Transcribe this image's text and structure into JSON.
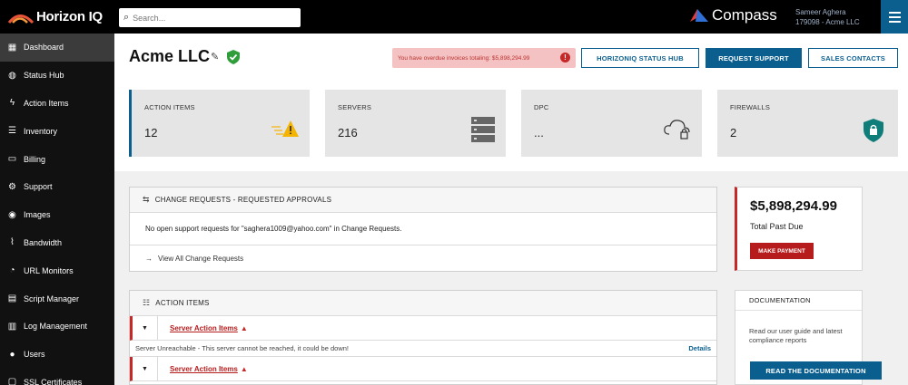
{
  "brand": {
    "name": "Horizon IQ"
  },
  "search": {
    "placeholder": "Search..."
  },
  "compass": {
    "label": "Compass"
  },
  "user": {
    "name": "Sameer Aghera",
    "account": "179098 - Acme LLC"
  },
  "sidebar": {
    "items": [
      {
        "label": "Dashboard",
        "icon": "dashboard-icon",
        "active": true
      },
      {
        "label": "Status Hub",
        "icon": "globe-icon"
      },
      {
        "label": "Action Items",
        "icon": "bolt-icon"
      },
      {
        "label": "Inventory",
        "icon": "server-icon"
      },
      {
        "label": "Billing",
        "icon": "card-icon"
      },
      {
        "label": "Support",
        "icon": "gear-icon"
      },
      {
        "label": "Images",
        "icon": "disc-icon"
      },
      {
        "label": "Bandwidth",
        "icon": "chart-icon"
      },
      {
        "label": "URL Monitors",
        "icon": "monitor-icon"
      },
      {
        "label": "Script Manager",
        "icon": "script-icon"
      },
      {
        "label": "Log Management",
        "icon": "log-icon"
      },
      {
        "label": "Users",
        "icon": "users-icon"
      },
      {
        "label": "SSL Certificates",
        "icon": "certificate-icon"
      }
    ]
  },
  "page": {
    "title": "Acme LLC"
  },
  "alert": {
    "text": "You have overdue invoices totaling: $5,898,294.99",
    "badge": "!"
  },
  "header_buttons": {
    "status_hub": "HORIZONIQ STATUS HUB",
    "request_support": "REQUEST SUPPORT",
    "sales_contacts": "SALES CONTACTS"
  },
  "stats": [
    {
      "label": "ACTION ITEMS",
      "value": "12"
    },
    {
      "label": "SERVERS",
      "value": "216"
    },
    {
      "label": "DPC",
      "value": "..."
    },
    {
      "label": "FIREWALLS",
      "value": "2"
    }
  ],
  "change_requests": {
    "title": "CHANGE REQUESTS - REQUESTED APPROVALS",
    "empty_text": "No open support requests for \"saghera1009@yahoo.com\" in Change Requests.",
    "link": "View All Change Requests"
  },
  "action_items": {
    "title": "ACTION ITEMS",
    "rows": [
      {
        "title": "Server Action Items",
        "detail": "Server Unreachable - This server cannot be reached, it could be down!",
        "details_link": "Details"
      },
      {
        "title": "Server Action Items"
      }
    ]
  },
  "past_due": {
    "amount": "$5,898,294.99",
    "label": "Total Past Due",
    "button": "MAKE PAYMENT"
  },
  "documentation": {
    "title": "DOCUMENTATION",
    "text": "Read our user guide and latest compliance reports",
    "button": "READ THE DOCUMENTATION"
  },
  "colors": {
    "accent": "#0b5f8f",
    "danger": "#c62828",
    "warning": "#f5b400",
    "firewall": "#0f7d7a"
  }
}
